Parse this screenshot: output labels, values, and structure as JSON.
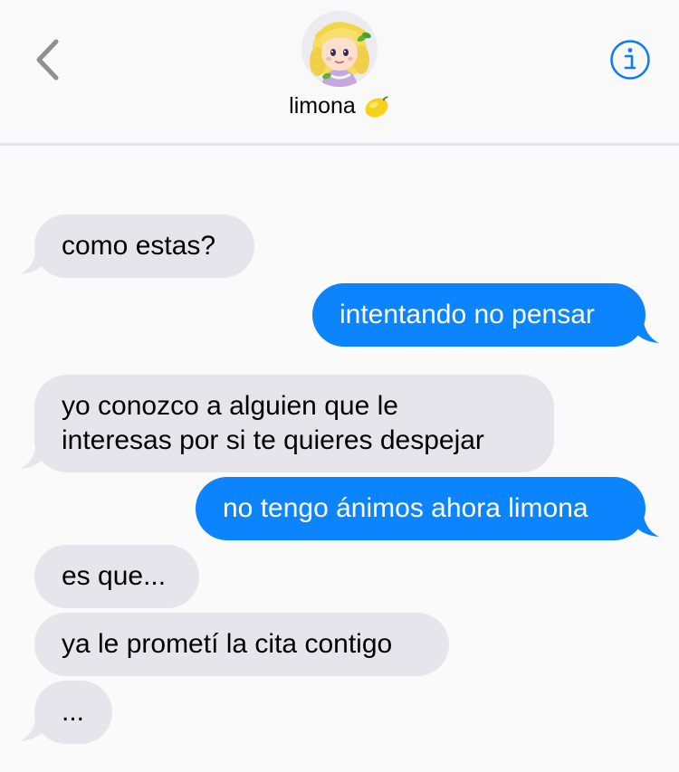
{
  "header": {
    "contact_name": "limona",
    "contact_emoji": "lemon-emoji",
    "back_icon": "chevron-left-icon",
    "info_icon": "info-icon"
  },
  "colors": {
    "incoming_bubble": "#e6e5eb",
    "outgoing_bubble": "#0b84fe",
    "accent": "#0a7afe",
    "background": "#fafafa"
  },
  "messages": [
    {
      "direction": "incoming",
      "lines": [
        "como estas?"
      ]
    },
    {
      "direction": "outgoing",
      "lines": [
        "intentando no pensar"
      ]
    },
    {
      "direction": "incoming",
      "lines": [
        "yo conozco a alguien que le",
        "interesas por si te quieres despejar"
      ]
    },
    {
      "direction": "outgoing",
      "lines": [
        "no tengo ánimos ahora limona"
      ]
    },
    {
      "direction": "incoming",
      "lines": [
        "es que..."
      ]
    },
    {
      "direction": "incoming",
      "lines": [
        "ya le prometí la cita contigo"
      ]
    },
    {
      "direction": "incoming",
      "lines": [
        "..."
      ]
    }
  ]
}
